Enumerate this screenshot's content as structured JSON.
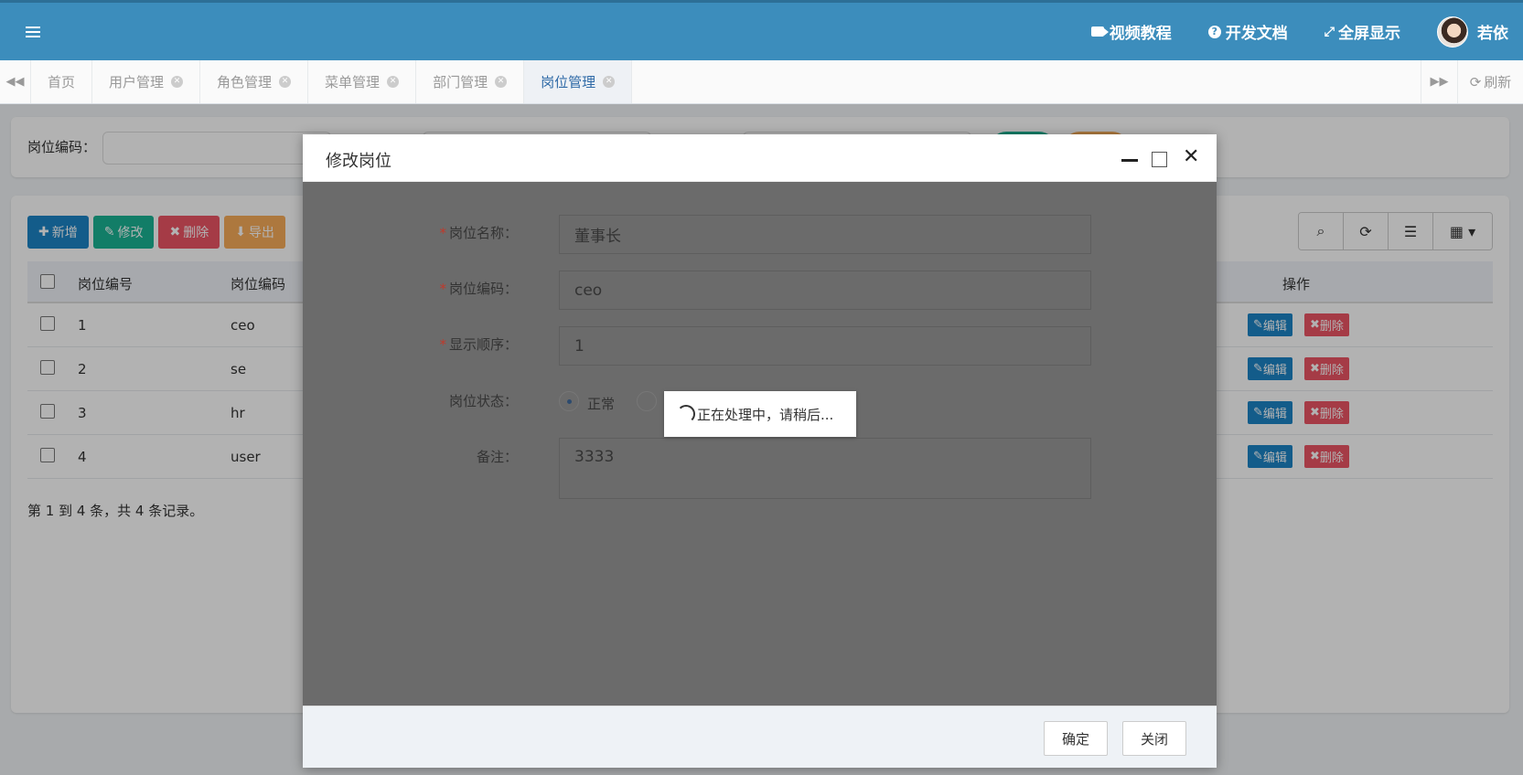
{
  "header": {
    "video_tutorial": "视频教程",
    "dev_docs": "开发文档",
    "fullscreen": "全屏显示",
    "user_name": "若依"
  },
  "tabs": [
    {
      "label": "首页",
      "closable": false,
      "active": false
    },
    {
      "label": "用户管理",
      "closable": true,
      "active": false
    },
    {
      "label": "角色管理",
      "closable": true,
      "active": false
    },
    {
      "label": "菜单管理",
      "closable": true,
      "active": false
    },
    {
      "label": "部门管理",
      "closable": true,
      "active": false
    },
    {
      "label": "岗位管理",
      "closable": true,
      "active": true
    }
  ],
  "refresh_label": "刷新",
  "search": {
    "post_code_label": "岗位编码："
  },
  "toolbar": {
    "add": "新增",
    "edit": "修改",
    "delete": "删除",
    "export": "导出"
  },
  "table": {
    "columns": [
      "岗位编号",
      "岗位编码"
    ],
    "action_column": "操作",
    "rows": [
      {
        "id": "1",
        "code": "ceo"
      },
      {
        "id": "2",
        "code": "se"
      },
      {
        "id": "3",
        "code": "hr"
      },
      {
        "id": "4",
        "code": "user"
      }
    ],
    "edit_label": "编辑",
    "delete_label": "删除",
    "pager_text": "第 1 到 4 条，共 4 条记录。"
  },
  "modal": {
    "title": "修改岗位",
    "fields": {
      "post_name_label": "岗位名称：",
      "post_name_value": "董事长",
      "post_code_label": "岗位编码：",
      "post_code_value": "ceo",
      "order_label": "显示顺序：",
      "order_value": "1",
      "status_label": "岗位状态：",
      "status_normal": "正常",
      "remark_label": "备注：",
      "remark_value": "3333"
    },
    "loading_text": "正在处理中，请稍后...",
    "confirm": "确定",
    "close": "关闭"
  },
  "colors": {
    "header_bg": "#3c8dbc",
    "primary": "#1c84c6",
    "success": "#1ab394",
    "danger": "#ed5565",
    "warning": "#f8ac59"
  }
}
